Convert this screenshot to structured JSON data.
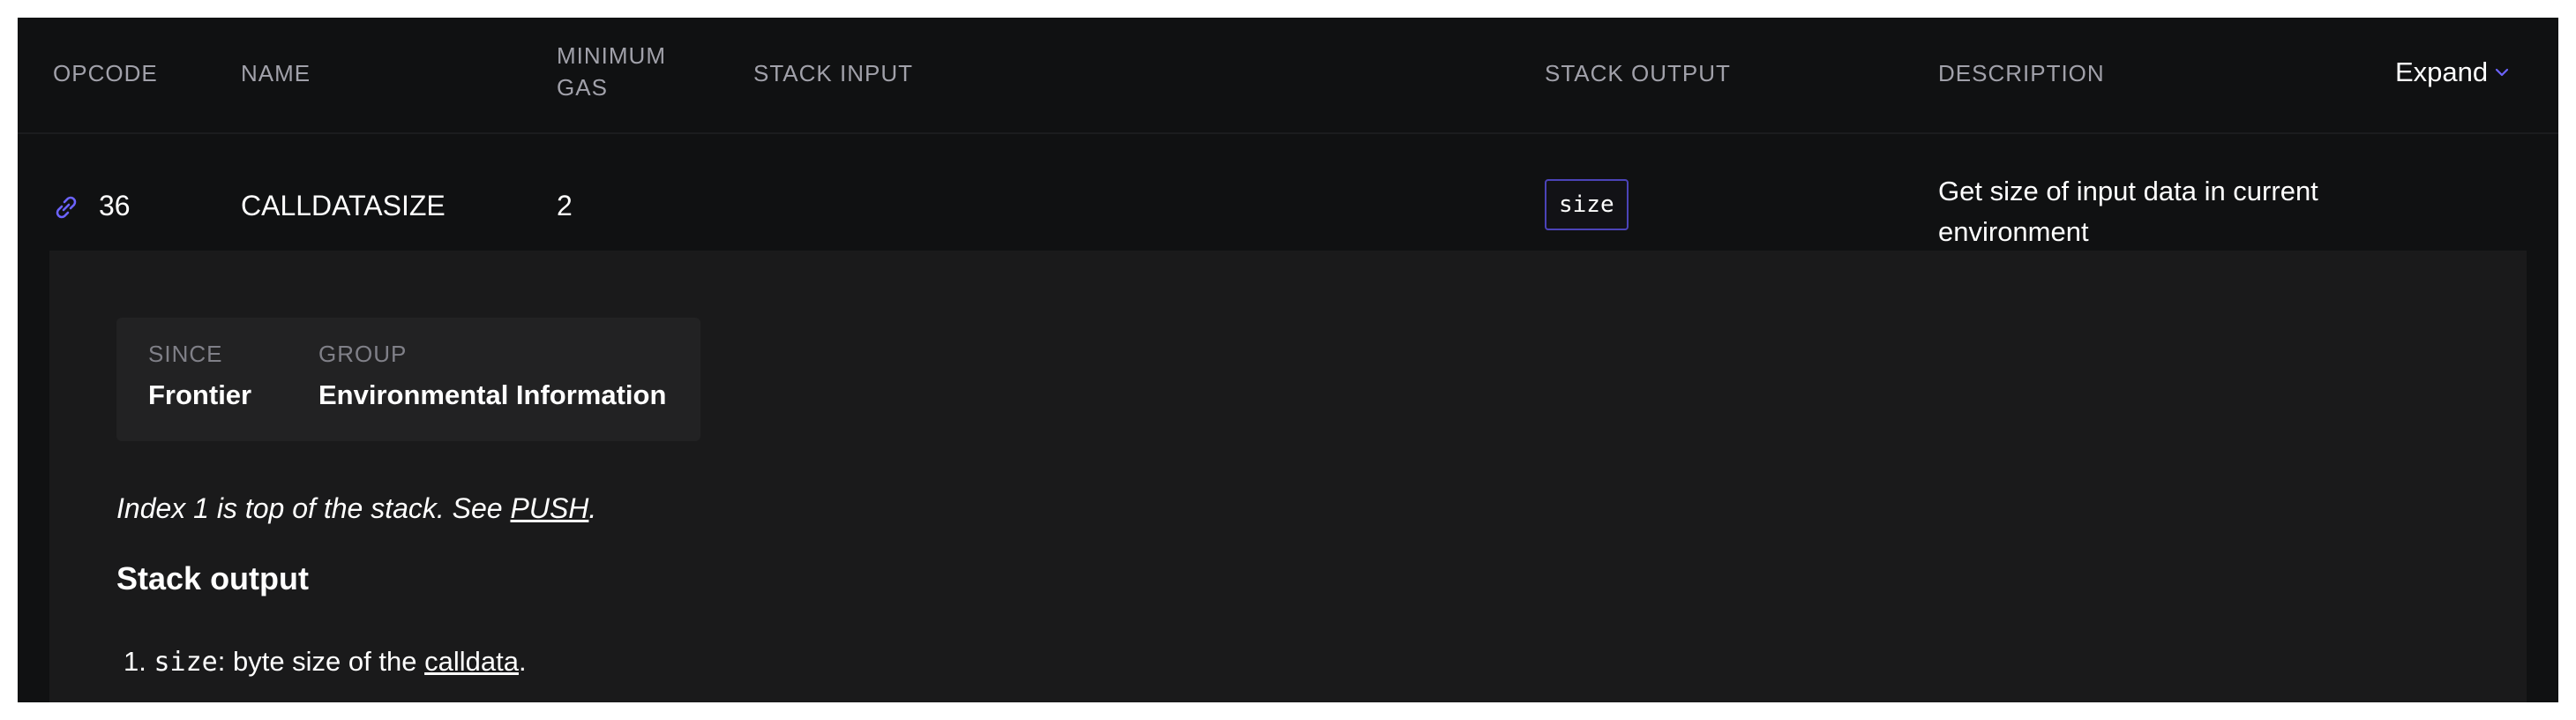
{
  "table": {
    "headers": {
      "opcode": "OPCODE",
      "name": "NAME",
      "minimum_gas_line1": "MINIMUM",
      "minimum_gas_line2": "GAS",
      "stack_input": "STACK INPUT",
      "stack_output": "STACK OUTPUT",
      "description": "DESCRIPTION"
    },
    "expand_label": "Expand",
    "row": {
      "opcode": "36",
      "name": "CALLDATASIZE",
      "minimum_gas": "2",
      "stack_output_chip": "size",
      "description_line1": "Get size of input data in current",
      "description_line2": "environment"
    }
  },
  "details": {
    "since_label": "SINCE",
    "since_value": "Frontier",
    "group_label": "GROUP",
    "group_value": "Environmental Information",
    "note_prefix": "Index 1 is top of the stack. See ",
    "note_link": "PUSH",
    "note_suffix": ".",
    "stack_output_title": "Stack output",
    "outputs": [
      {
        "number": "1.",
        "code": "size",
        "text": ": byte size of the ",
        "link": "calldata",
        "suffix": "."
      }
    ]
  },
  "icons": {
    "row_link": "link-icon",
    "expand": "chevron-down-icon"
  },
  "colors": {
    "background": "#101112",
    "details_background": "#1a1a1b",
    "header_text": "#a1a1aa",
    "accent": "#6c63ff",
    "chip_border": "#4b43b8"
  }
}
